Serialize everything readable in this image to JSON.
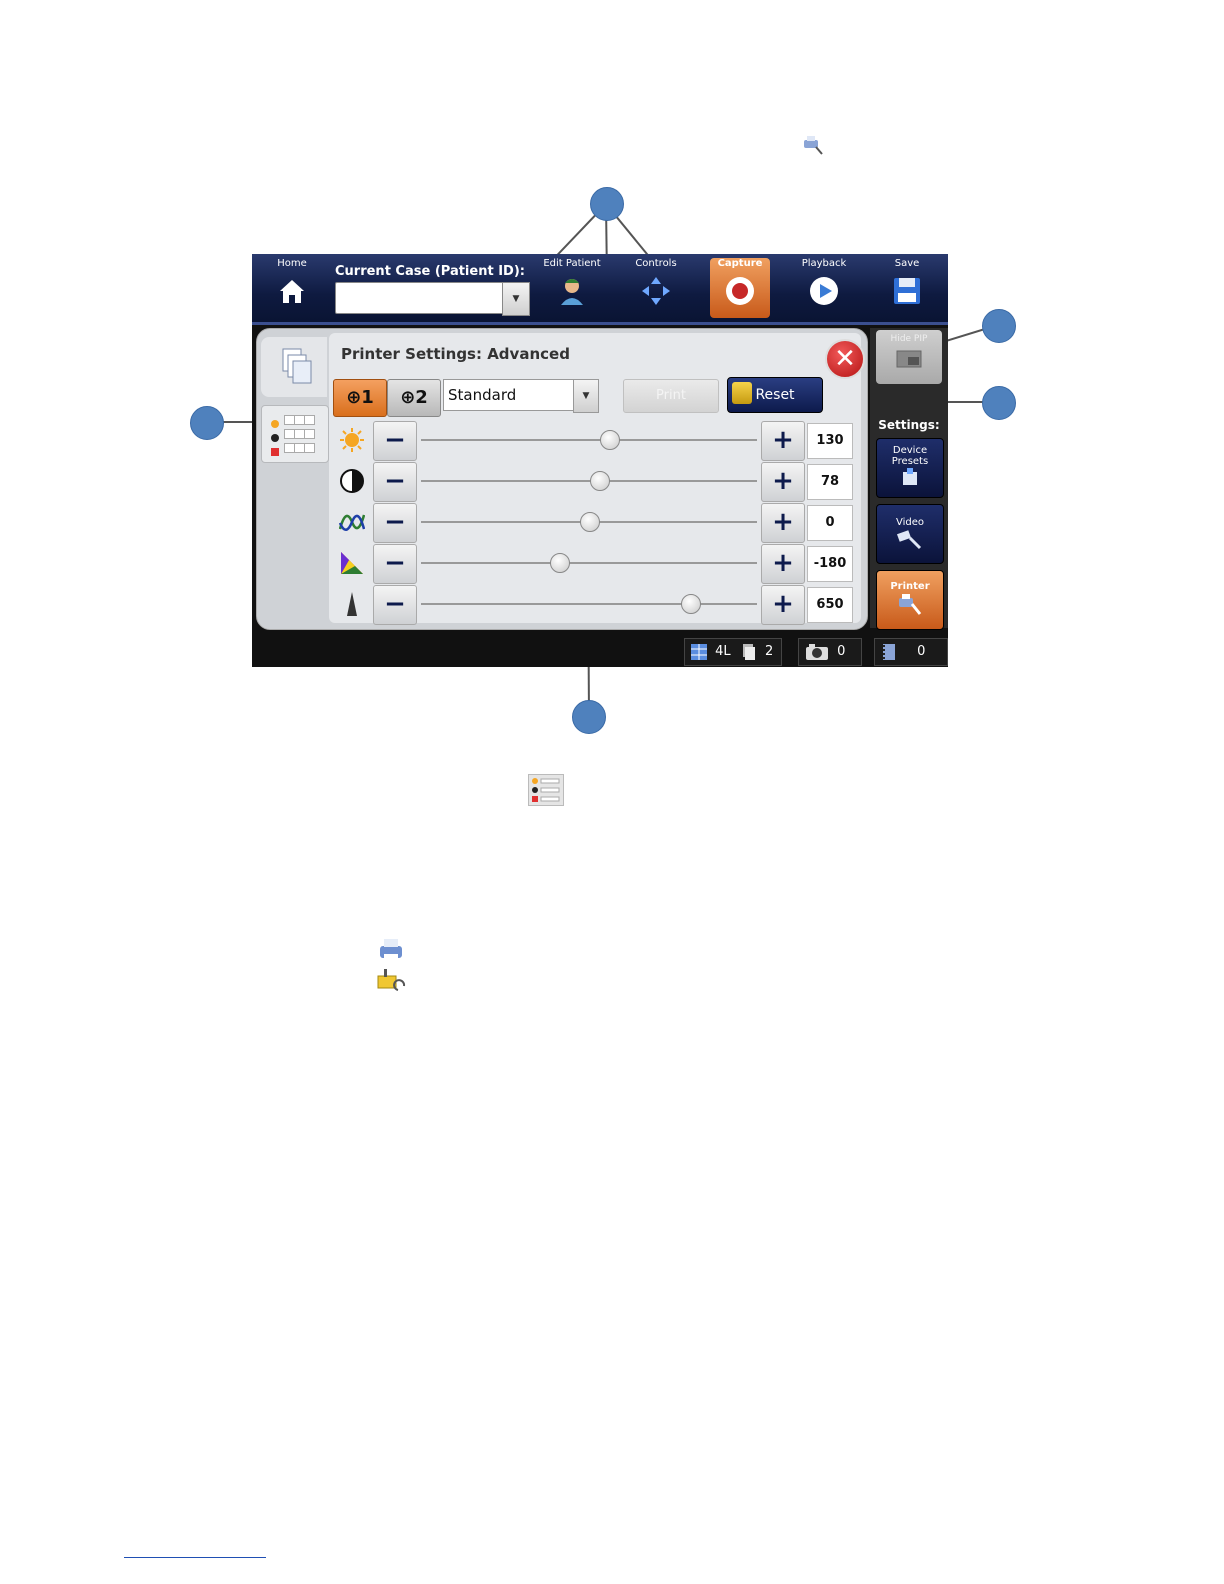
{
  "screen": {
    "nav": {
      "home": "Home",
      "case_label": "Current Case (Patient ID):",
      "case_value": "",
      "edit_patient": "Edit Patient",
      "controls": "Controls",
      "capture": "Capture",
      "playback": "Playback",
      "save": "Save"
    },
    "panel": {
      "title": "Printer Settings: Advanced",
      "close": "✕",
      "source1": "⊕1",
      "source2": "⊕2",
      "preset_select": "Standard",
      "print_label": "Print",
      "reset_label": "Reset",
      "sliders": [
        {
          "name": "brightness",
          "icon": "sun-icon",
          "value": "130",
          "level": 0.56
        },
        {
          "name": "contrast",
          "icon": "contrast-icon",
          "value": "78",
          "level": 0.53
        },
        {
          "name": "sharpness",
          "icon": "wave-icon",
          "value": "0",
          "level": 0.5
        },
        {
          "name": "color",
          "icon": "color-wheel-icon",
          "value": "-180",
          "level": 0.41
        },
        {
          "name": "gamma",
          "icon": "gamma-wedge-icon",
          "value": "650",
          "level": 0.8
        }
      ]
    },
    "sidebar": {
      "hide_pip": "Hide PIP",
      "settings_label": "Settings:",
      "device_presets": "Device Presets",
      "video": "Video",
      "printer": "Printer"
    },
    "status": {
      "layout": "4L",
      "copies": "2",
      "photos": "0",
      "videos": "0"
    }
  },
  "colors": {
    "accent_orange": "#d96f1c",
    "navy": "#0d1a4c",
    "callout_blue": "#4f81bd"
  }
}
